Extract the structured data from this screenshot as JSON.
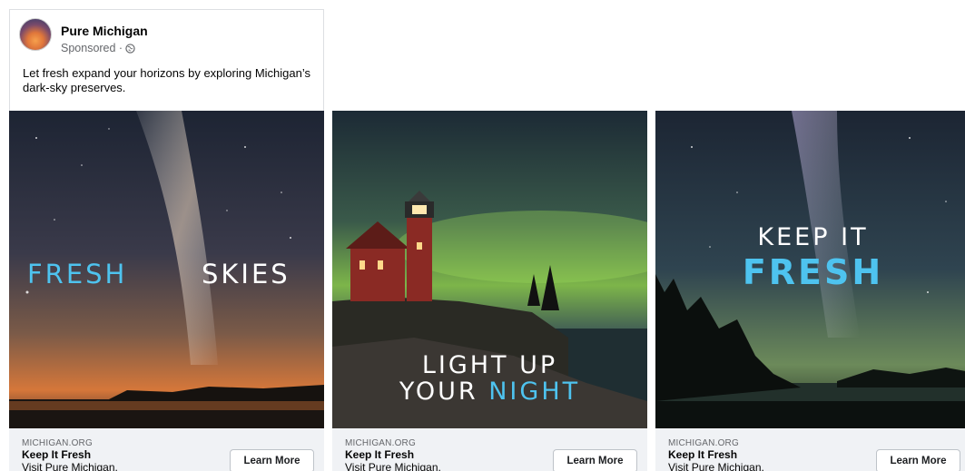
{
  "post": {
    "page_name": "Pure Michigan",
    "sponsored": "Sponsored · ",
    "text": "Let fresh expand your horizons by exploring Michigan’s dark-sky preserves."
  },
  "cards": [
    {
      "overlay_left": "FRESH",
      "overlay_right": "SKIES",
      "domain": "MICHIGAN.ORG",
      "headline": "Keep It Fresh",
      "description": "Visit Pure Michigan.",
      "cta": "Learn More"
    },
    {
      "overlay_line1": "LIGHT UP",
      "overlay_line2a": "YOUR ",
      "overlay_line2b": "NIGHT",
      "domain": "MICHIGAN.ORG",
      "headline": "Keep It Fresh",
      "description": "Visit Pure Michigan.",
      "cta": "Learn More"
    },
    {
      "overlay_line1": "KEEP IT",
      "overlay_line2": "FRESH",
      "domain": "MICHIGAN.ORG",
      "headline": "Keep It Fresh",
      "description": "Visit Pure Michigan.",
      "cta": "Learn More"
    }
  ],
  "colors": {
    "accent_blue": "#4ec3ef",
    "card_footer_bg": "#f0f2f5",
    "meta_gray": "#65676b"
  },
  "icons": [
    "globe-icon"
  ]
}
